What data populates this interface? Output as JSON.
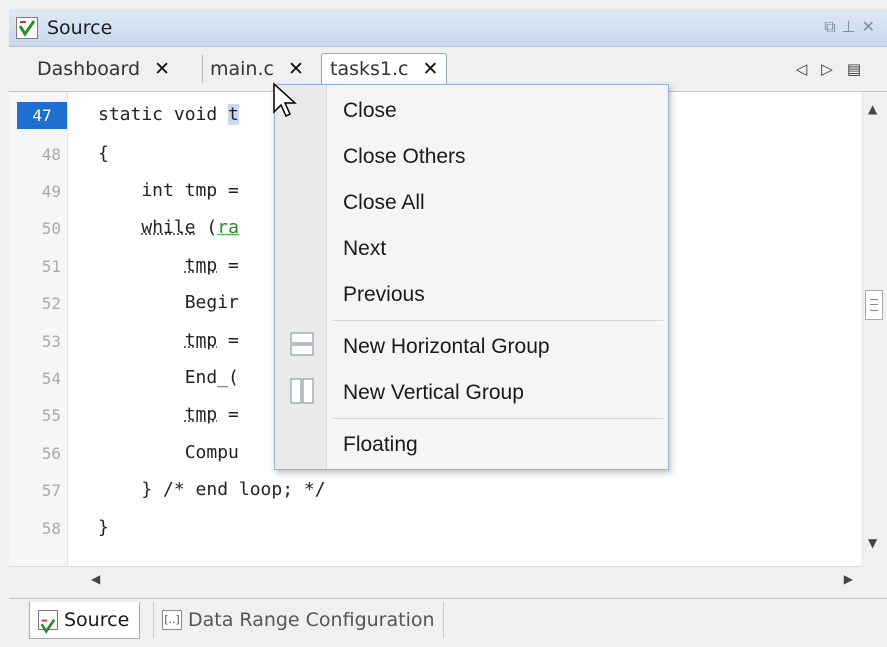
{
  "window": {
    "title": "Source"
  },
  "tabs": [
    {
      "label": "Dashboard",
      "close": "✕"
    },
    {
      "label": "main.c",
      "close": "✕"
    },
    {
      "label": "tasks1.c",
      "close": "✕",
      "active": true
    }
  ],
  "gutter": {
    "lines": [
      "47",
      "48",
      "49",
      "50",
      "51",
      "52",
      "53",
      "54",
      "55",
      "56",
      "57",
      "58"
    ],
    "current": "47"
  },
  "code": {
    "l47": "static void ",
    "l47b": "t",
    "l48": "{",
    "l49": "    int tmp =",
    "l50a": "    ",
    "l50b": "while",
    "l50c": " (",
    "l50d": "ra",
    "l51a": "        ",
    "l51b": "tmp",
    "l51c": " =",
    "l52": "        Begir",
    "l53a": "        ",
    "l53b": "tmp",
    "l53c": " =",
    "l54": "        End_(",
    "l55a": "        ",
    "l55b": "tmp",
    "l55c": " =",
    "l56": "        Compu",
    "l57": "    } /* end loop; */",
    "l58": "}"
  },
  "context_menu": {
    "items": [
      "Close",
      "Close Others",
      "Close All",
      "Next",
      "Previous",
      "New Horizontal Group",
      "New Vertical Group",
      "Floating"
    ]
  },
  "bottom_tabs": [
    {
      "label": "Source",
      "icon": "source-logo-icon"
    },
    {
      "label": "Data Range Configuration",
      "icon": "bracket-icon",
      "icon_glyph": "[..]"
    }
  ],
  "colors": {
    "current_line": "#1f6fd1",
    "menu_border": "#97b4d8",
    "titlebar": "#c9d8ec"
  }
}
